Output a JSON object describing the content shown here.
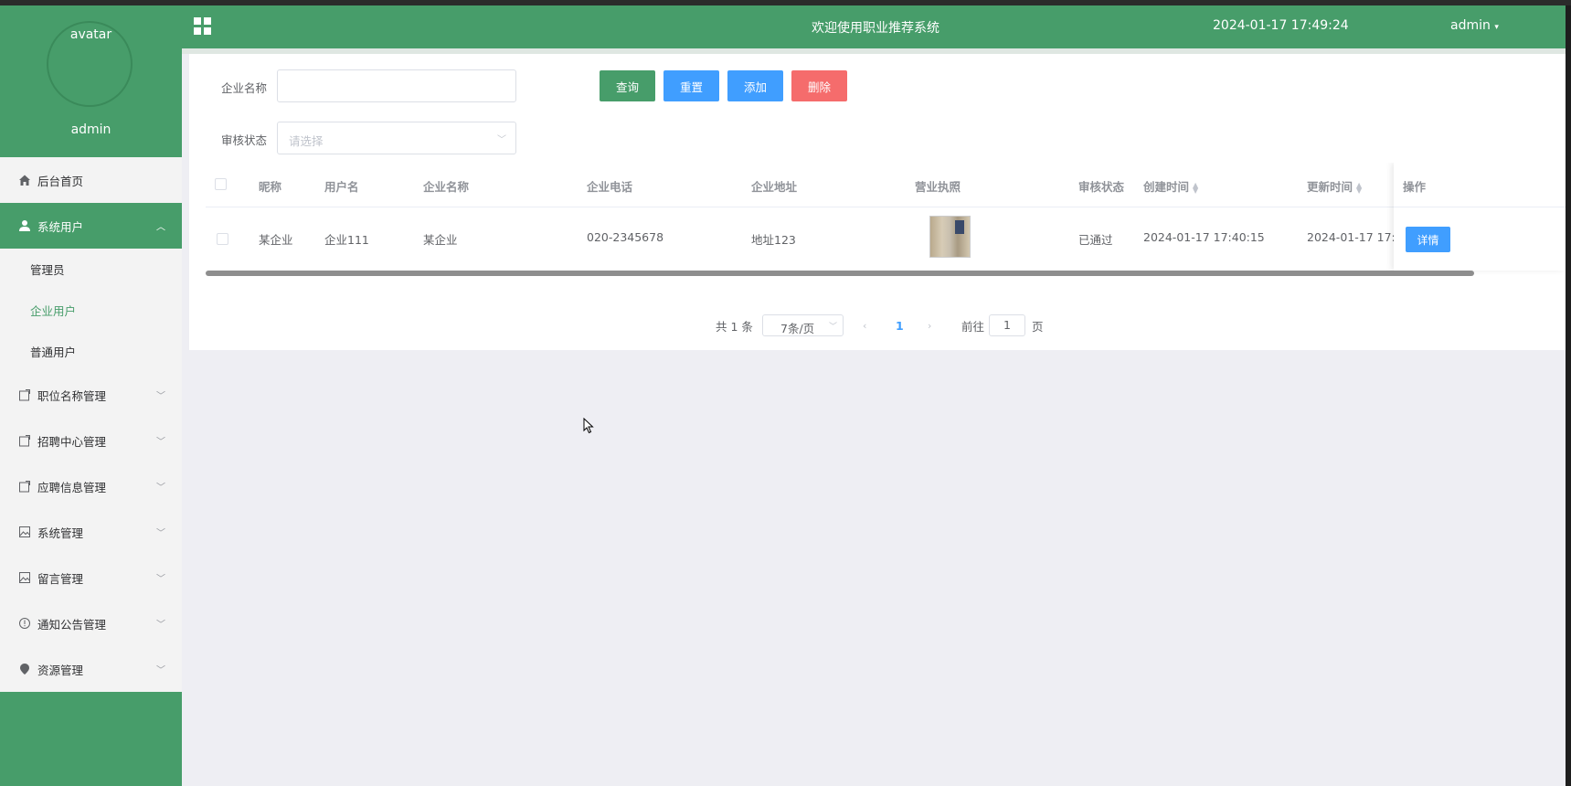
{
  "sidebar": {
    "avatar_alt": "avatar",
    "username": "admin",
    "menu": [
      {
        "label": "后台首页",
        "icon": "home-icon"
      },
      {
        "label": "系统用户",
        "icon": "user-icon",
        "expanded": true,
        "children": [
          "管理员",
          "企业用户",
          "普通用户"
        ],
        "current_child": "企业用户"
      },
      {
        "label": "职位名称管理",
        "icon": "document-icon"
      },
      {
        "label": "招聘中心管理",
        "icon": "document-icon"
      },
      {
        "label": "应聘信息管理",
        "icon": "document-icon"
      },
      {
        "label": "系统管理",
        "icon": "image-icon"
      },
      {
        "label": "留言管理",
        "icon": "image-icon"
      },
      {
        "label": "通知公告管理",
        "icon": "info-circle-icon"
      },
      {
        "label": "资源管理",
        "icon": "location-icon"
      }
    ]
  },
  "header": {
    "title": "欢迎使用职业推荐系统",
    "datetime": "2024-01-17 17:49:24",
    "user": "admin"
  },
  "search": {
    "company_label": "企业名称",
    "company_value": "",
    "status_label": "审核状态",
    "status_placeholder": "请选择"
  },
  "buttons": {
    "query": "查询",
    "reset": "重置",
    "add": "添加",
    "delete": "删除"
  },
  "table": {
    "columns": [
      "昵称",
      "用户名",
      "企业名称",
      "企业电话",
      "企业地址",
      "营业执照",
      "审核状态",
      "创建时间",
      "更新时间",
      "操作"
    ],
    "rows": [
      {
        "nickname": "某企业",
        "username": "企业111",
        "company": "某企业",
        "phone": "020-2345678",
        "address": "地址123",
        "status": "已通过",
        "created": "2024-01-17 17:40:15",
        "updated": "2024-01-17 17:",
        "action": "详情"
      }
    ]
  },
  "pagination": {
    "total": "共 1 条",
    "page_size": "7条/页",
    "current_page": "1",
    "goto_label": "前往",
    "goto_value": "1",
    "page_suffix": "页"
  },
  "colors": {
    "primary_green": "#479d6a",
    "blue": "#409eff",
    "delete_red": "#f56c6c"
  }
}
